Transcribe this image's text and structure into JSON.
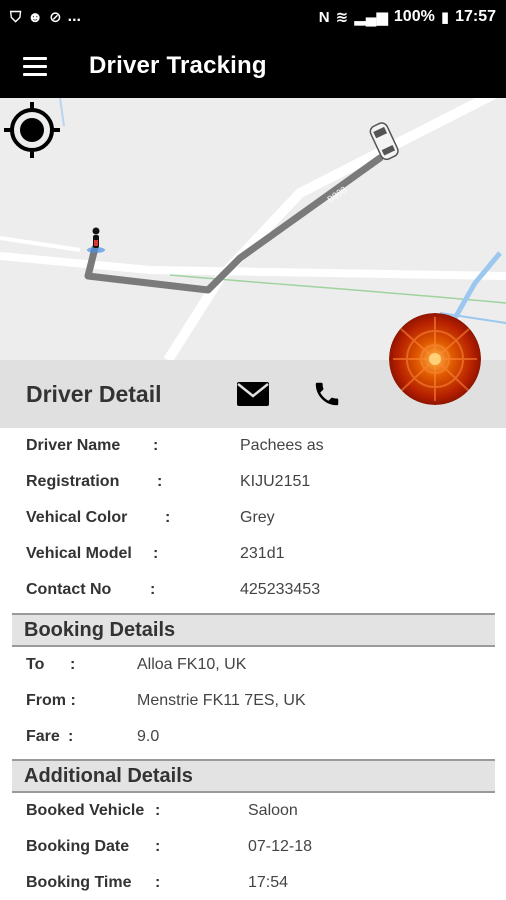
{
  "status_bar": {
    "battery": "100%",
    "time": "17:57",
    "left_icons": [
      "shield-icon",
      "face-icon",
      "no-signal-icon",
      "more-dots"
    ],
    "right_icons": [
      "nfc-icon",
      "wifi-icon",
      "signal-icon",
      "battery-icon"
    ],
    "more": "..."
  },
  "app_bar": {
    "title": "Driver Tracking"
  },
  "map": {
    "road_label": "B998"
  },
  "driver_detail": {
    "title": "Driver Detail",
    "rows": [
      {
        "label": "Driver Name",
        "sep": ":",
        "value": "Pachees as"
      },
      {
        "label": "Registration",
        "sep": ":",
        "value": "KIJU2151"
      },
      {
        "label": "Vehical Color",
        "sep": ":",
        "value": "Grey"
      },
      {
        "label": "Vehical Model",
        "sep": ":",
        "value": "231d1"
      },
      {
        "label": "Contact No",
        "sep": ":",
        "value": "425233453"
      }
    ]
  },
  "booking_details": {
    "title": "Booking Details",
    "rows": [
      {
        "label": "To",
        "sep": ":",
        "value": "Alloa FK10, UK"
      },
      {
        "label": "From :",
        "value": "Menstrie FK11 7ES, UK"
      },
      {
        "label": "Fare",
        "sep": ":",
        "value": "9.0"
      }
    ]
  },
  "additional_details": {
    "title": "Additional Details",
    "rows": [
      {
        "label": "Booked Vehicle",
        "sep": ":",
        "value": "Saloon"
      },
      {
        "label": "Booking Date",
        "sep": ":",
        "value": "07-12-18"
      },
      {
        "label": "Booking Time",
        "sep": ":",
        "value": "17:54"
      }
    ]
  }
}
